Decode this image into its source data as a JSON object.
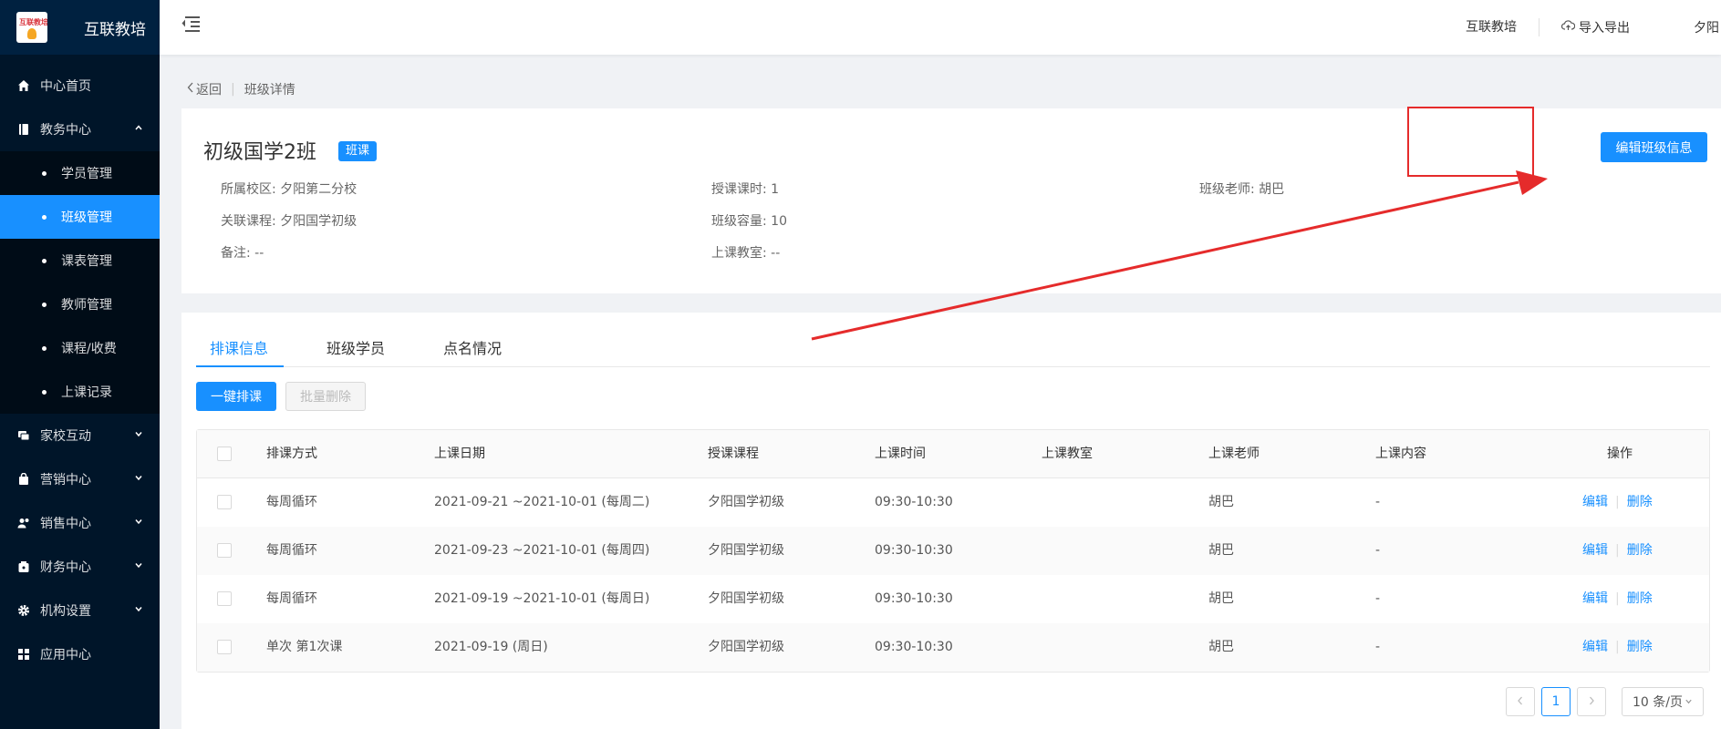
{
  "app": {
    "name": "互联教培",
    "logo_text": "互联教培"
  },
  "sidebar": {
    "items": [
      {
        "label": "中心首页",
        "icon": "home-icon"
      },
      {
        "label": "教务中心",
        "icon": "book-icon",
        "expanded": true,
        "children": [
          {
            "label": "学员管理"
          },
          {
            "label": "班级管理",
            "active": true
          },
          {
            "label": "课表管理"
          },
          {
            "label": "教师管理"
          },
          {
            "label": "课程/收费"
          },
          {
            "label": "上课记录"
          }
        ]
      },
      {
        "label": "家校互动",
        "icon": "chat-icon"
      },
      {
        "label": "营销中心",
        "icon": "bag-icon"
      },
      {
        "label": "销售中心",
        "icon": "users-icon"
      },
      {
        "label": "财务中心",
        "icon": "wallet-icon"
      },
      {
        "label": "机构设置",
        "icon": "gear-icon"
      },
      {
        "label": "应用中心",
        "icon": "grid-icon"
      }
    ]
  },
  "header": {
    "org": "互联教培",
    "import_export": "导入导出",
    "user": "夕阳"
  },
  "breadcrumb": {
    "back": "返回",
    "sep": "|",
    "current": "班级详情"
  },
  "class_info": {
    "title": "初级国学2班",
    "tag": "班课",
    "edit_button": "编辑班级信息",
    "fields": {
      "campus": "所属校区: 夕阳第二分校",
      "hours": "授课课时: 1",
      "teacher": "班级老师:  胡巴",
      "course": "关联课程: 夕阳国学初级",
      "capacity": "班级容量: 10",
      "note": "备注: --",
      "classroom": "上课教室: --"
    }
  },
  "tabs": [
    "排课信息",
    "班级学员",
    "点名情况"
  ],
  "actions": {
    "auto_schedule": "一键排课",
    "batch_delete": "批量删除"
  },
  "table": {
    "columns": [
      "排课方式",
      "上课日期",
      "授课课程",
      "上课时间",
      "上课教室",
      "上课老师",
      "上课内容",
      "操作"
    ],
    "rows": [
      {
        "mode": "每周循环",
        "date": "2021-09-21 ~2021-10-01 (每周二)",
        "course": "夕阳国学初级",
        "time": "09:30-10:30",
        "room": "",
        "teacher": "胡巴",
        "content": "-"
      },
      {
        "mode": "每周循环",
        "date": "2021-09-23 ~2021-10-01 (每周四)",
        "course": "夕阳国学初级",
        "time": "09:30-10:30",
        "room": "",
        "teacher": "胡巴",
        "content": "-"
      },
      {
        "mode": "每周循环",
        "date": "2021-09-19 ~2021-10-01 (每周日)",
        "course": "夕阳国学初级",
        "time": "09:30-10:30",
        "room": "",
        "teacher": "胡巴",
        "content": "-"
      },
      {
        "mode": "单次 第1次课",
        "date": "2021-09-19 (周日)",
        "course": "夕阳国学初级",
        "time": "09:30-10:30",
        "room": "",
        "teacher": "胡巴",
        "content": "-"
      }
    ],
    "edit_label": "编辑",
    "delete_label": "删除",
    "op_sep": "|"
  },
  "pagination": {
    "current": "1",
    "page_size": "10 条/页"
  },
  "colors": {
    "primary": "#1890ff",
    "sidebar": "#001529",
    "annotation": "#e52b2b"
  }
}
